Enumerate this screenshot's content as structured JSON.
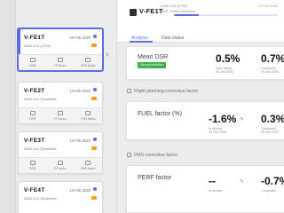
{
  "list": {
    "cards": [
      {
        "registration": "V-FE1T",
        "date": "20 Feb 2020",
        "subtitle": "A320-214 (CFM)",
        "actions": [
          "DSR",
          "FP factor",
          "FMS factor"
        ]
      },
      {
        "registration": "V-FE2T",
        "date": "13 Feb 2020",
        "subtitle": "A320-214 (Sharklets",
        "actions": [
          "DSR",
          "FP factor",
          "FMS factor"
        ]
      },
      {
        "registration": "V-FE3T",
        "date": "13 Feb 2020",
        "subtitle": "A320-214 (Sharklets",
        "actions": [
          "DSR",
          "FP factor",
          "FMS factor"
        ]
      },
      {
        "registration": "V-FE4T",
        "date": "13 Feb 2020",
        "subtitle": "A320-214 (Sharklets",
        "actions": []
      }
    ]
  },
  "panel": {
    "title": "V-FE1T",
    "aircraft_type": "A320-214 (CFM)",
    "fms": "FMS: Thales Avionics",
    "date_range": "13 Feb 2020",
    "tabs": [
      "Analysis",
      "Data status"
    ],
    "mean_dsr": {
      "label": "Mean DSR",
      "chip": "Strong evolution",
      "last_value": "0.5%",
      "last_value_caption": "Last values\n20 Jan 2020",
      "computed": "0.7%",
      "computed_caption": "Computed\n20 Jan 2020"
    },
    "section_fp": "Flight planning corrective factor",
    "fuel_factor": {
      "label": "FUEL factor (%)",
      "in_service": "-1.6%",
      "in_service_caption": "In service\n14 Feb 2020",
      "computed": "0.3%",
      "computed_caption": "Computed\n20 Jan 2020"
    },
    "section_fms": "FMS corrective factor",
    "perf_factor": {
      "label": "PERF factor",
      "in_service": "--",
      "in_service_caption": "In service",
      "computed": "-0.7%",
      "computed_caption": "Computed"
    }
  },
  "colors": {
    "accent": "#5b6ee1",
    "chip": "#37b24d",
    "badge": "#f0a020"
  }
}
